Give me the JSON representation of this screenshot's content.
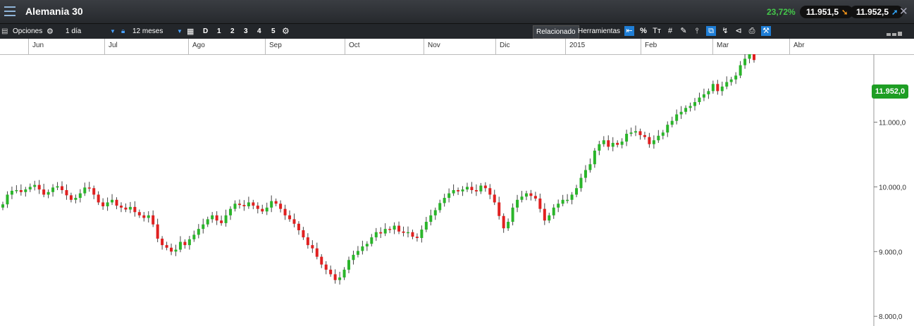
{
  "window": {
    "title": "Alemania 30",
    "change_pct": "23,72%",
    "sell_price": "11.951,5",
    "buy_price": "11.952,5"
  },
  "toolbar": {
    "options_label": "Opciones",
    "interval": "1 día",
    "range": "12 meses",
    "period_buttons": [
      "D",
      "1",
      "2",
      "3",
      "4",
      "5"
    ],
    "related_label": "Relacionado",
    "tools_label": "Herramientas",
    "tools_icons": [
      "crosshair-icon",
      "percent-icon",
      "text-icon",
      "grid-icon",
      "draw-icon",
      "candle-icon",
      "compare-icon",
      "indicator-icon",
      "tag-icon",
      "print-icon",
      "settings-active-icon"
    ]
  },
  "colors": {
    "up": "#2ab52a",
    "down": "#e02020",
    "last_price_bg": "#1e9e24"
  },
  "chart_data": {
    "type": "candlestick",
    "x_tick_labels": [
      "Jun",
      "Jul",
      "Ago",
      "Sep",
      "Oct",
      "Nov",
      "Dic",
      "2015",
      "Feb",
      "Mar",
      "Abr"
    ],
    "y_tick_labels": [
      "11.000,0",
      "10.000,0",
      "9.000,0",
      "8.000,0"
    ],
    "y_ticks": [
      11000,
      10000,
      9000,
      8000
    ],
    "ylim": [
      7850,
      12050
    ],
    "last_price_label": "11.952,0",
    "last_price": 11952,
    "close_series": [
      9730,
      9880,
      9940,
      9950,
      9920,
      9960,
      10000,
      10030,
      9960,
      9880,
      9920,
      9990,
      10010,
      9950,
      9870,
      9800,
      9830,
      9900,
      9990,
      9980,
      9880,
      9760,
      9700,
      9760,
      9800,
      9710,
      9680,
      9650,
      9690,
      9610,
      9560,
      9520,
      9560,
      9420,
      9200,
      9100,
      9060,
      9000,
      9030,
      9150,
      9100,
      9190,
      9260,
      9350,
      9420,
      9500,
      9560,
      9480,
      9440,
      9560,
      9660,
      9740,
      9720,
      9700,
      9760,
      9710,
      9660,
      9620,
      9680,
      9780,
      9740,
      9660,
      9560,
      9500,
      9430,
      9330,
      9220,
      9100,
      9050,
      8920,
      8800,
      8720,
      8650,
      8560,
      8600,
      8720,
      8870,
      8950,
      9010,
      9080,
      9120,
      9220,
      9300,
      9280,
      9350,
      9340,
      9400,
      9310,
      9290,
      9300,
      9230,
      9210,
      9340,
      9460,
      9560,
      9640,
      9750,
      9830,
      9900,
      9950,
      9930,
      9960,
      10000,
      9950,
      9930,
      10020,
      9980,
      9880,
      9760,
      9550,
      9360,
      9460,
      9680,
      9800,
      9850,
      9900,
      9860,
      9820,
      9660,
      9480,
      9560,
      9680,
      9740,
      9800,
      9800,
      9880,
      9980,
      10140,
      10260,
      10350,
      10560,
      10660,
      10720,
      10620,
      10680,
      10650,
      10700,
      10820,
      10840,
      10860,
      10800,
      10770,
      10660,
      10720,
      10790,
      10840,
      10960,
      11020,
      11120,
      11160,
      11220,
      11250,
      11310,
      11380,
      11430,
      11480,
      11590,
      11480,
      11550,
      11620,
      11660,
      11720,
      11880,
      11980,
      12140,
      11960
    ],
    "open_series": [
      9680,
      9730,
      9880,
      9940,
      9950,
      9920,
      9960,
      10000,
      10030,
      9960,
      9880,
      9920,
      9990,
      10010,
      9950,
      9870,
      9800,
      9830,
      9900,
      9990,
      9980,
      9880,
      9760,
      9700,
      9760,
      9800,
      9710,
      9680,
      9650,
      9690,
      9610,
      9560,
      9520,
      9560,
      9420,
      9200,
      9100,
      9060,
      9000,
      9030,
      9150,
      9100,
      9190,
      9260,
      9350,
      9420,
      9500,
      9560,
      9480,
      9440,
      9560,
      9660,
      9740,
      9720,
      9700,
      9760,
      9710,
      9660,
      9620,
      9680,
      9780,
      9740,
      9660,
      9560,
      9500,
      9430,
      9330,
      9220,
      9100,
      9050,
      8920,
      8800,
      8720,
      8650,
      8560,
      8600,
      8720,
      8870,
      8950,
      9010,
      9080,
      9120,
      9220,
      9300,
      9280,
      9350,
      9340,
      9400,
      9310,
      9290,
      9300,
      9230,
      9210,
      9340,
      9460,
      9560,
      9640,
      9750,
      9830,
      9900,
      9950,
      9930,
      9960,
      10000,
      9950,
      9930,
      10020,
      9980,
      9880,
      9760,
      9550,
      9360,
      9460,
      9680,
      9800,
      9850,
      9900,
      9860,
      9820,
      9660,
      9480,
      9560,
      9680,
      9740,
      9800,
      9800,
      9880,
      9980,
      10140,
      10260,
      10350,
      10560,
      10660,
      10720,
      10620,
      10680,
      10650,
      10700,
      10820,
      10840,
      10860,
      10800,
      10770,
      10660,
      10720,
      10790,
      10840,
      10960,
      11020,
      11120,
      11160,
      11220,
      11250,
      11310,
      11380,
      11430,
      11480,
      11590,
      11480,
      11550,
      11620,
      11660,
      11720,
      11880,
      11980,
      12140
    ]
  }
}
